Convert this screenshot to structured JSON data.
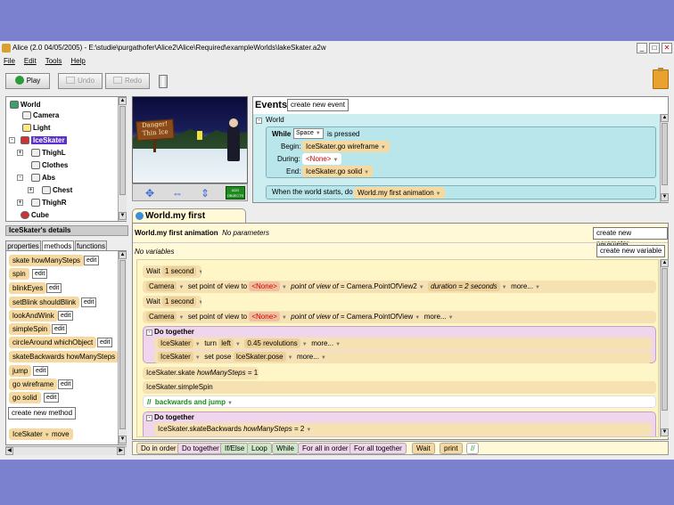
{
  "window": {
    "title": "Alice (2.0 04/05/2005) - E:\\studie\\purgathofer\\Alice2\\Alice\\Required\\exampleWorlds\\lakeSkater.a2w",
    "buttons": {
      "minimize": "_",
      "maximize": "□",
      "close": "✕"
    }
  },
  "menu": [
    "File",
    "Edit",
    "Tools",
    "Help"
  ],
  "toolbar": {
    "play": "Play",
    "undo": "Undo",
    "redo": "Redo"
  },
  "object_tree": {
    "items": [
      {
        "label": "World"
      },
      {
        "label": "Camera"
      },
      {
        "label": "Light"
      },
      {
        "label": "IceSkater"
      },
      {
        "label": "ThighL"
      },
      {
        "label": "Clothes"
      },
      {
        "label": "Abs"
      },
      {
        "label": "Chest"
      },
      {
        "label": "ThighR"
      },
      {
        "label": "Cube"
      }
    ]
  },
  "scene": {
    "sign_line1": "Danger!",
    "sign_line2": "Thin Ice",
    "add_objects": "ADD OBJECTS"
  },
  "details": {
    "title": "IceSkater's details",
    "tabs": [
      "properties",
      "methods",
      "functions"
    ],
    "active_tab": "methods",
    "methods": [
      {
        "name": "skate",
        "param": "howManySteps"
      },
      {
        "name": "spin",
        "param": ""
      },
      {
        "name": "blinkEyes",
        "param": ""
      },
      {
        "name": "setBlink",
        "param": "shouldBlink"
      },
      {
        "name": "lookAndWink",
        "param": ""
      },
      {
        "name": "simpleSpin",
        "param": ""
      },
      {
        "name": "circleAround",
        "param": "whichObject"
      },
      {
        "name": "skateBackwards",
        "param": "howManySteps"
      },
      {
        "name": "jump",
        "param": ""
      },
      {
        "name": "go wireframe",
        "param": ""
      },
      {
        "name": "go solid",
        "param": ""
      }
    ],
    "edit_label": "edit",
    "create_method": "create new method",
    "bottom_tile": {
      "object": "IceSkater",
      "method": "move"
    }
  },
  "events": {
    "title": "Events",
    "create_event": "create new event",
    "world_label": "World",
    "while": {
      "label": "While",
      "key": "Space",
      "suffix": "is pressed",
      "begin_label": "Begin:",
      "begin_value": "IceSkater.go wireframe",
      "during_label": "During:",
      "during_value": "<None>",
      "end_label": "End:",
      "end_value": "IceSkater.go solid"
    },
    "start": {
      "label": "When the world starts,  do",
      "value": "World.my first animation"
    }
  },
  "editor": {
    "tab": "World.my first animation",
    "header": {
      "name": "World.my first animation",
      "params": "No parameters",
      "create_param": "create new parameter"
    },
    "vars": {
      "label": "No variables",
      "create_var": "create new variable"
    },
    "lines": [
      {
        "type": "wait",
        "text": "Wait",
        "value": "1 second"
      },
      {
        "type": "pov",
        "obj": "Camera",
        "cmd": "set point of view to",
        "target": "<None>",
        "kw": "point of view of",
        "target2": "= Camera.PointOfView2",
        "dur": "duration = 2 seconds",
        "more": "more..."
      },
      {
        "type": "wait",
        "text": "Wait",
        "value": "1 second"
      },
      {
        "type": "pov",
        "obj": "Camera",
        "cmd": "set point of view to",
        "target": "<None>",
        "kw": "point of view of",
        "target2": "= Camera.PointOfView",
        "dur": "",
        "more": "more..."
      },
      {
        "type": "do_together",
        "text": "Do together"
      },
      {
        "type": "turn",
        "obj": "IceSkater",
        "cmd": "turn",
        "dir": "left",
        "amount": "0.45 revolutions",
        "more": "more..."
      },
      {
        "type": "pose",
        "obj": "IceSkater",
        "cmd": "set pose",
        "pose": "IceSkater.pose",
        "more": "more..."
      },
      {
        "type": "skate",
        "text": "IceSkater.skate",
        "param": "howManySteps",
        "value": "= 1"
      },
      {
        "type": "spin",
        "text": "IceSkater.simpleSpin"
      },
      {
        "type": "comment",
        "slashes": "//",
        "text": "backwards and jump"
      },
      {
        "type": "do_together",
        "text": "Do together"
      },
      {
        "type": "skate",
        "text": "IceSkater.skateBackwards",
        "param": "howManySteps",
        "value": "= 2"
      }
    ],
    "controls": [
      "Do in order",
      "Do together",
      "If/Else",
      "Loop",
      "While",
      "For all in order",
      "For all together",
      "Wait",
      "print",
      "//"
    ]
  },
  "colors": {
    "background": "#7b80cf",
    "selection": "#5b2fd0",
    "method_tile": "#f5d9a0",
    "events_bg": "#cdeef0"
  }
}
